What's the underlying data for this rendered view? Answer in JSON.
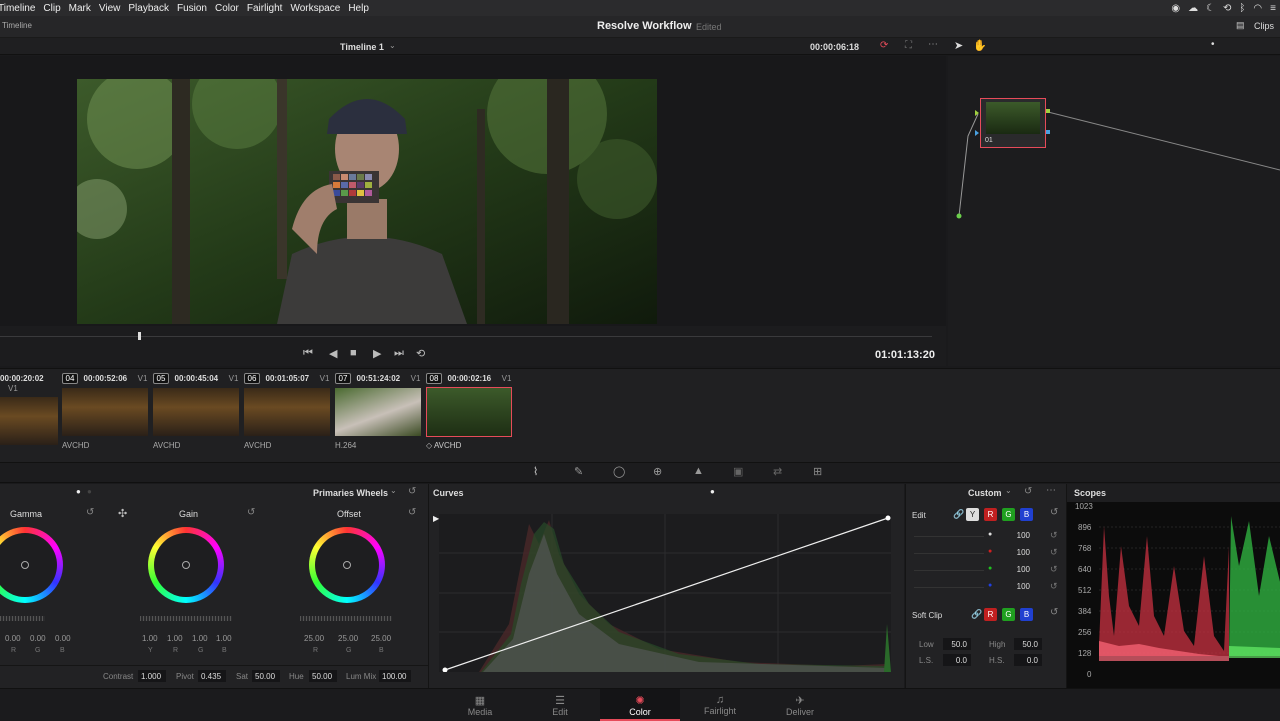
{
  "menubar": {
    "items": [
      "Timeline",
      "Clip",
      "Mark",
      "View",
      "Playback",
      "Fusion",
      "Color",
      "Fairlight",
      "Workspace",
      "Help"
    ],
    "clips_label": "Clips"
  },
  "titlebar": {
    "left_label": "Timeline",
    "project": "Resolve Workflow",
    "status": "Edited"
  },
  "viewer": {
    "timeline_name": "Timeline 1",
    "timecode": "00:00:06:18",
    "playhead_timecode": "01:01:13:20"
  },
  "node": {
    "label": "01"
  },
  "clips": [
    {
      "num": "",
      "tc": "00:00:20:02",
      "track": "V1",
      "codec": ""
    },
    {
      "num": "04",
      "tc": "00:00:52:06",
      "track": "V1",
      "codec": "AVCHD"
    },
    {
      "num": "05",
      "tc": "00:00:45:04",
      "track": "V1",
      "codec": "AVCHD"
    },
    {
      "num": "06",
      "tc": "00:01:05:07",
      "track": "V1",
      "codec": "AVCHD"
    },
    {
      "num": "07",
      "tc": "00:51:24:02",
      "track": "V1",
      "codec": "H.264"
    },
    {
      "num": "08",
      "tc": "00:00:02:16",
      "track": "V1",
      "codec": "AVCHD"
    }
  ],
  "wheels": {
    "mode": "Primaries Wheels",
    "gamma": {
      "title": "Gamma",
      "values": [
        "0.00",
        "0.00",
        "0.00"
      ],
      "channels": [
        "R",
        "G",
        "B"
      ]
    },
    "gain": {
      "title": "Gain",
      "values": [
        "1.00",
        "1.00",
        "1.00",
        "1.00"
      ],
      "channels": [
        "Y",
        "R",
        "G",
        "B"
      ]
    },
    "offset": {
      "title": "Offset",
      "values": [
        "25.00",
        "25.00",
        "25.00"
      ],
      "channels": [
        "R",
        "G",
        "B"
      ]
    },
    "bottom": {
      "contrast_label": "Contrast",
      "contrast": "1.000",
      "pivot_label": "Pivot",
      "pivot": "0.435",
      "sat_label": "Sat",
      "sat": "50.00",
      "hue_label": "Hue",
      "hue": "50.00",
      "lummix_label": "Lum Mix",
      "lummix": "100.00"
    }
  },
  "curves": {
    "title": "Curves"
  },
  "custom": {
    "mode": "Custom",
    "edit_label": "Edit",
    "channel_buttons": [
      "Y",
      "R",
      "G",
      "B"
    ],
    "values": [
      "100",
      "100",
      "100",
      "100"
    ],
    "softclip_label": "Soft Clip",
    "low_label": "Low",
    "low": "50.0",
    "high_label": "High",
    "high": "50.0",
    "ls_label": "L.S.",
    "ls": "0.0",
    "hs_label": "H.S.",
    "hs": "0.0"
  },
  "scopes": {
    "title": "Scopes",
    "scale": [
      "1023",
      "896",
      "768",
      "640",
      "512",
      "384",
      "256",
      "128",
      "0"
    ]
  },
  "pages": [
    "Media",
    "Edit",
    "Color",
    "Fairlight",
    "Deliver"
  ],
  "active_page": "Color",
  "colors": {
    "accent": "#e64b5a",
    "active_page": "#e64b5a"
  }
}
